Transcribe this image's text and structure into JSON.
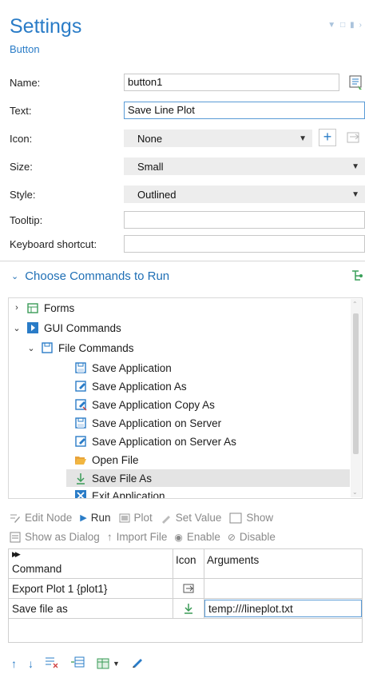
{
  "header": {
    "title": "Settings",
    "subtitle": "Button"
  },
  "form": {
    "name_label": "Name:",
    "name_value": "button1",
    "text_label": "Text:",
    "text_value": "Save Line Plot",
    "icon_label": "Icon:",
    "icon_value": "None",
    "size_label": "Size:",
    "size_value": "Small",
    "style_label": "Style:",
    "style_value": "Outlined",
    "tooltip_label": "Tooltip:",
    "tooltip_value": "",
    "shortcut_label": "Keyboard shortcut:",
    "shortcut_value": ""
  },
  "section": {
    "title": "Choose Commands to Run"
  },
  "tree": {
    "forms": "Forms",
    "gui_commands": "GUI Commands",
    "file_commands": "File Commands",
    "items": [
      "Save Application",
      "Save Application As",
      "Save Application Copy As",
      "Save Application on Server",
      "Save Application on Server As",
      "Open File",
      "Save File As",
      "Exit Application"
    ]
  },
  "toolbar": {
    "edit_node": "Edit Node",
    "run": "Run",
    "plot": "Plot",
    "set_value": "Set Value",
    "show": "Show",
    "show_as_dialog": "Show as Dialog",
    "import_file": "Import File",
    "enable": "Enable",
    "disable": "Disable"
  },
  "table": {
    "headers": {
      "command": "Command",
      "icon": "Icon",
      "arguments": "Arguments"
    },
    "rows": [
      {
        "command": "Export Plot 1 {plot1}",
        "arguments": ""
      },
      {
        "command": "Save file as",
        "arguments": "temp:///lineplot.txt"
      }
    ]
  },
  "colors": {
    "accent": "#2a7cc7",
    "selected_row": "#e4e4e4"
  }
}
